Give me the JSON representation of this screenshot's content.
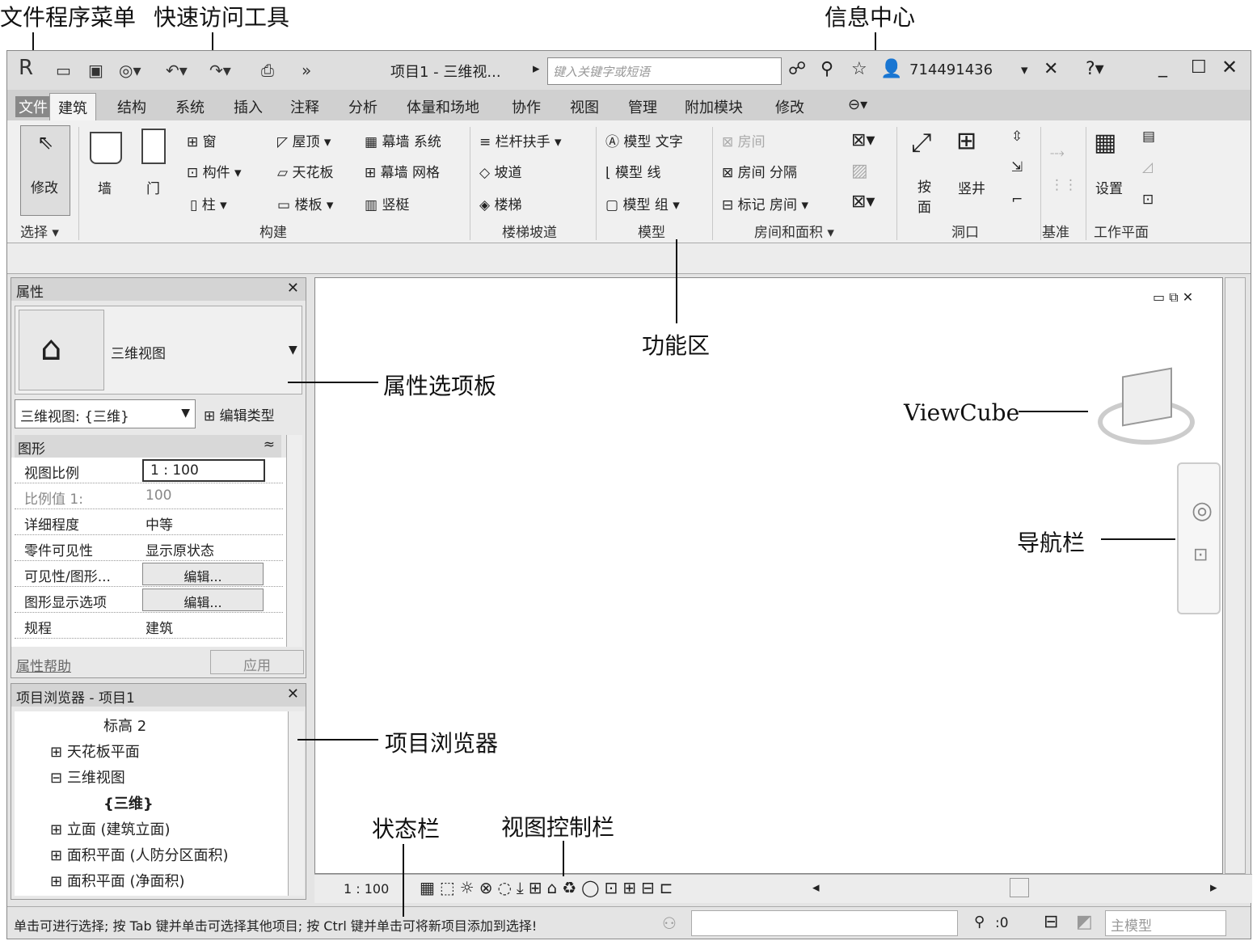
{
  "callouts": {
    "file_menu": "文件程序菜单",
    "quick_access": "快速访问工具",
    "info_center": "信息中心",
    "ribbon": "功能区",
    "properties_palette": "属性选项板",
    "viewcube": "ViewCube",
    "nav_bar": "导航栏",
    "project_browser": "项目浏览器",
    "status_bar": "状态栏",
    "view_control_bar": "视图控制栏"
  },
  "titlebar": {
    "title": "项目1 - 三维视...",
    "search_placeholder": "键入关键字或短语",
    "user_id": "714491436"
  },
  "tabs": [
    "文件",
    "建筑",
    "结构",
    "系统",
    "插入",
    "注释",
    "分析",
    "体量和场地",
    "协作",
    "视图",
    "管理",
    "附加模块",
    "修改"
  ],
  "ribbon": {
    "select_modify": "修改",
    "select_group": "选择 ▾",
    "wall": "墙",
    "door": "门",
    "window": "窗",
    "component": "构件",
    "column": "柱",
    "roof": "屋顶",
    "ceiling": "天花板",
    "floor": "楼板",
    "curtain_system": "幕墙 系统",
    "curtain_grid": "幕墙 网格",
    "mullion": "竖梃",
    "build_group": "构建",
    "railing": "栏杆扶手",
    "ramp": "坡道",
    "stair": "楼梯",
    "stair_group": "楼梯坡道",
    "model_text": "模型 文字",
    "model_line": "模型 线",
    "model_group": "模型 组",
    "model_group_label": "模型",
    "room": "房间",
    "room_separator": "房间 分隔",
    "tag_room": "标记 房间",
    "room_area_group": "房间和面积 ▾",
    "by_face": "按面",
    "shaft": "竖井",
    "opening_group": "洞口",
    "datum_group": "基准",
    "set": "设置",
    "workplane_group": "工作平面"
  },
  "properties": {
    "header": "属性",
    "type_name": "三维视图",
    "type_selector": "三维视图: {三维}",
    "edit_type": "编辑类型",
    "section": "图形",
    "rows": [
      {
        "k": "视图比例",
        "v": "1 : 100"
      },
      {
        "k": "比例值 1:",
        "v": "100"
      },
      {
        "k": "详细程度",
        "v": "中等"
      },
      {
        "k": "零件可见性",
        "v": "显示原状态"
      },
      {
        "k": "可见性/图形...",
        "v": "编辑..."
      },
      {
        "k": "图形显示选项",
        "v": "编辑..."
      },
      {
        "k": "规程",
        "v": "建筑"
      }
    ],
    "help": "属性帮助",
    "apply": "应用"
  },
  "browser": {
    "header": "项目浏览器 - 项目1",
    "items": [
      "标高 2",
      "天花板平面",
      "三维视图",
      "{三维}",
      "立面 (建筑立面)",
      "面积平面 (人防分区面积)",
      "面积平面 (净面积)"
    ]
  },
  "viewctl": {
    "scale": "1 : 100"
  },
  "status": {
    "message": "单击可进行选择; 按 Tab 键并单击可选择其他项目; 按 Ctrl 键并单击可将新项目添加到选择!",
    "count": ":0",
    "model": "主模型"
  }
}
